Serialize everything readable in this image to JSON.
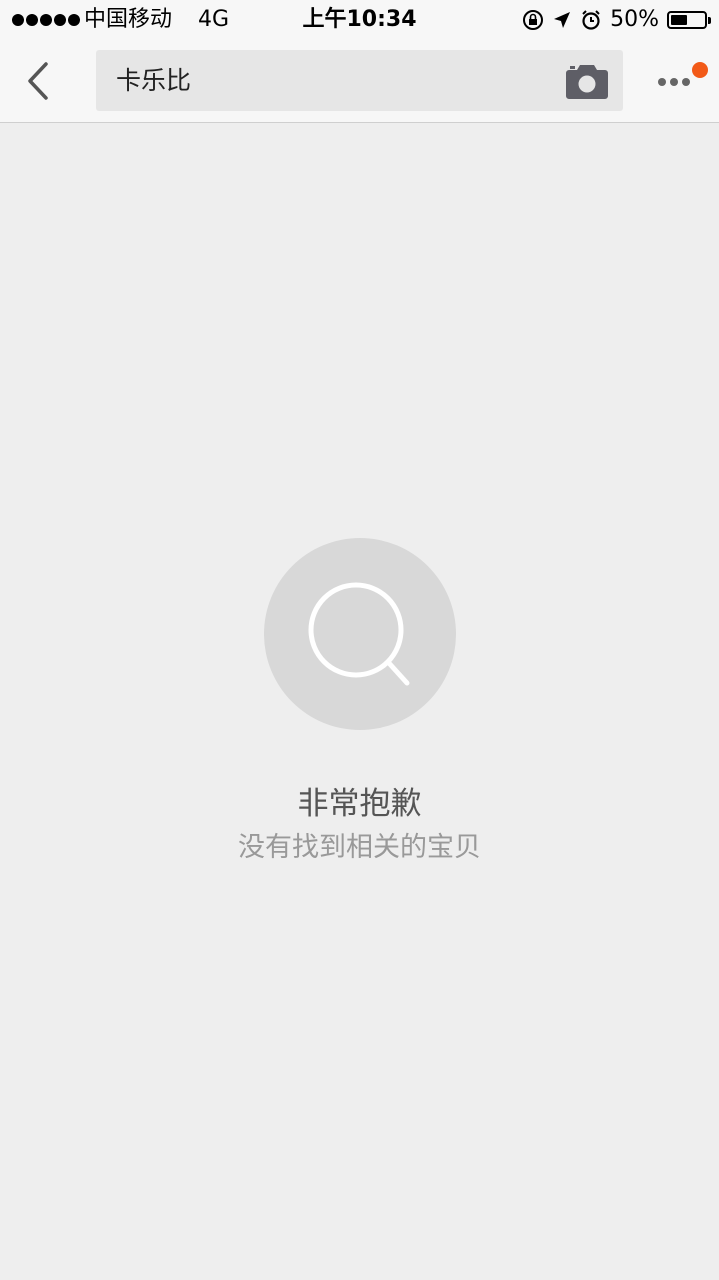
{
  "status_bar": {
    "signal_bars": 5,
    "carrier": "中国移动",
    "network": "4G",
    "time": "上午10:34",
    "battery_text": "50%",
    "battery_level": 0.5,
    "icons": [
      "orientation-lock-icon",
      "location-arrow-icon",
      "alarm-icon"
    ]
  },
  "nav": {
    "back_icon": "chevron-left-icon",
    "search_query": "卡乐比",
    "camera_icon": "camera-icon",
    "more_icon": "more-dots-icon",
    "notification_color": "#f25a18"
  },
  "empty_state": {
    "icon": "search-icon",
    "title": "非常抱歉",
    "subtitle": "没有找到相关的宝贝"
  }
}
